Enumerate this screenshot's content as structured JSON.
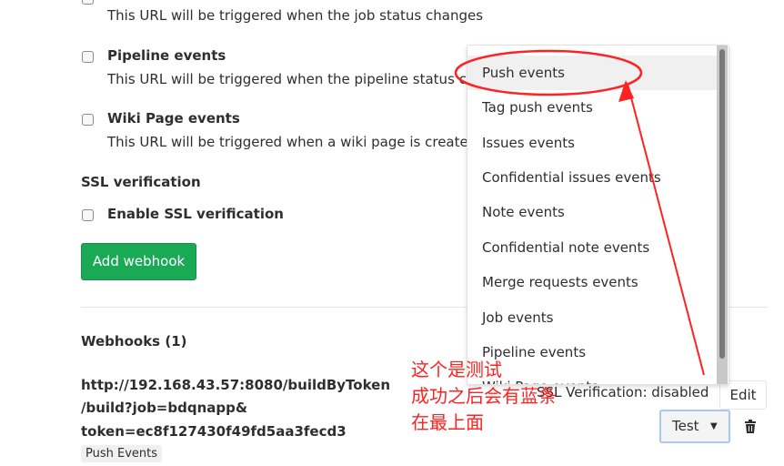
{
  "form": {
    "job_events_desc": "This URL will be triggered when the job status changes",
    "pipeline_events_label": "Pipeline events",
    "pipeline_events_desc": "This URL will be triggered when the pipeline status ch",
    "wiki_events_label": "Wiki Page events",
    "wiki_events_desc": "This URL will be triggered when a wiki page is created",
    "ssl_title": "SSL verification",
    "ssl_label": "Enable SSL verification",
    "add_button": "Add webhook"
  },
  "webhooks": {
    "title": "Webhooks (1)",
    "url_line1": "http://192.168.43.57:8080/buildByToken",
    "url_line2": "/build?job=bdqnapp&",
    "url_line3": "token=ec8f127430f49fd5aa3fecd3",
    "badge": "Push Events",
    "ssl_status": "SSL Verification: disabled",
    "edit_button": "Edit",
    "test_button": "Test",
    "delete_icon": "trash-icon"
  },
  "dropdown": {
    "items": [
      {
        "label": "Push events"
      },
      {
        "label": "Tag push events"
      },
      {
        "label": "Issues events"
      },
      {
        "label": "Confidential issues events"
      },
      {
        "label": "Note events"
      },
      {
        "label": "Confidential note events"
      },
      {
        "label": "Merge requests events"
      },
      {
        "label": "Job events"
      },
      {
        "label": "Pipeline events"
      },
      {
        "label": "Wiki Page events"
      }
    ]
  },
  "annotation": {
    "line1": "这个是测试",
    "line2": "成功之后会有蓝条",
    "line3": "在最上面",
    "color": "#ff2222"
  }
}
